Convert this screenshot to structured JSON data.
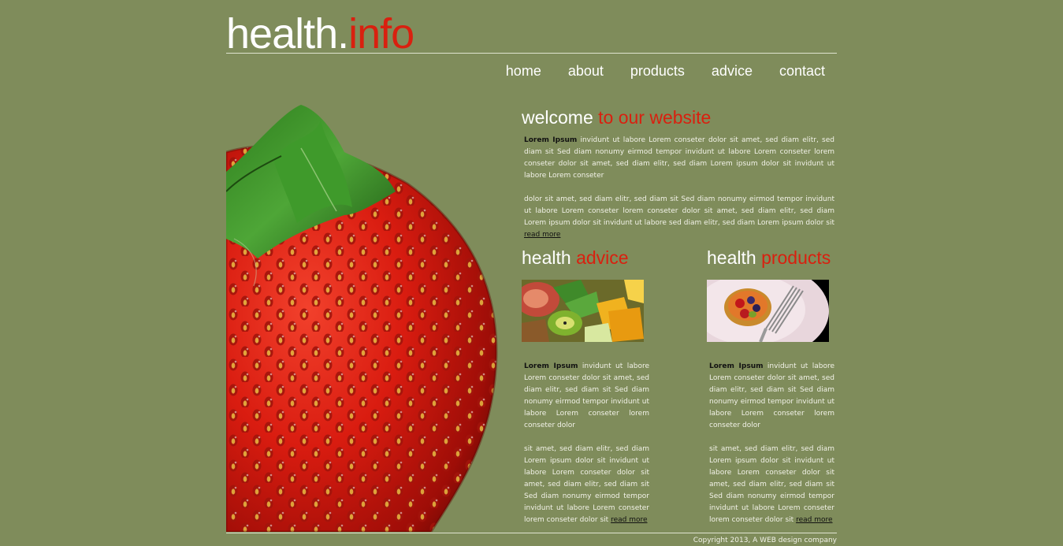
{
  "logo": {
    "part1": "health.",
    "part2": "info"
  },
  "nav": {
    "items": [
      {
        "label": "home"
      },
      {
        "label": "about"
      },
      {
        "label": "products"
      },
      {
        "label": "advice"
      },
      {
        "label": "contact"
      }
    ]
  },
  "welcome": {
    "title_white": "welcome",
    "title_red": " to our website",
    "bold_lead": "Lorem Ipsum",
    "p1": " invidunt ut labore Lorem conseter dolor sit amet, sed diam elitr, sed diam sit Sed diam nonumy eirmod tempor invidunt ut labore Lorem conseter lorem conseter dolor sit amet, sed diam elitr, sed diam Lorem ipsum dolor sit invidunt ut labore Lorem conseter",
    "p2": "dolor sit amet, sed diam elitr, sed diam sit Sed diam nonumy eirmod tempor invidunt ut labore Lorem conseter lorem conseter dolor sit amet, sed diam elitr, sed diam Lorem ipsum dolor sit invidunt ut labore sed diam elitr, sed diam Lorem ipsum dolor sit ",
    "read_more": "read more"
  },
  "advice": {
    "title_white": "health ",
    "title_red": "advice",
    "bold_lead": "Lorem Ipsum",
    "p1": " invidunt ut labore Lorem conseter dolor sit amet, sed diam elitr, sed diam sit Sed diam nonumy eirmod tempor invidunt ut labore Lorem conseter lorem conseter dolor",
    "p2": "sit amet, sed diam elitr, sed diam Lorem ipsum dolor sit invidunt ut labore Lorem conseter dolor sit amet, sed diam elitr, sed diam sit Sed diam nonumy eirmod tempor invidunt ut labore Lorem conseter lorem conseter dolor sit ",
    "read_more": "read more"
  },
  "products": {
    "title_white": "health ",
    "title_red": "products",
    "bold_lead": "Lorem Ipsum",
    "p1": " invidunt ut labore Lorem conseter dolor sit amet, sed diam elitr, sed diam sit Sed diam nonumy eirmod tempor invidunt ut labore Lorem conseter lorem conseter dolor",
    "p2": "sit amet, sed diam elitr, sed diam Lorem ipsum dolor sit invidunt ut labore Lorem conseter dolor sit amet, sed diam elitr, sed diam sit Sed diam nonumy eirmod tempor invidunt ut labore Lorem conseter lorem conseter dolor sit ",
    "read_more": "read more"
  },
  "footer": {
    "copyright": "Copyright 2013, A WEB design company"
  },
  "colors": {
    "background": "#7f8c5b",
    "accent": "#d9200f",
    "text": "#f2f2e8",
    "link": "#111111"
  }
}
